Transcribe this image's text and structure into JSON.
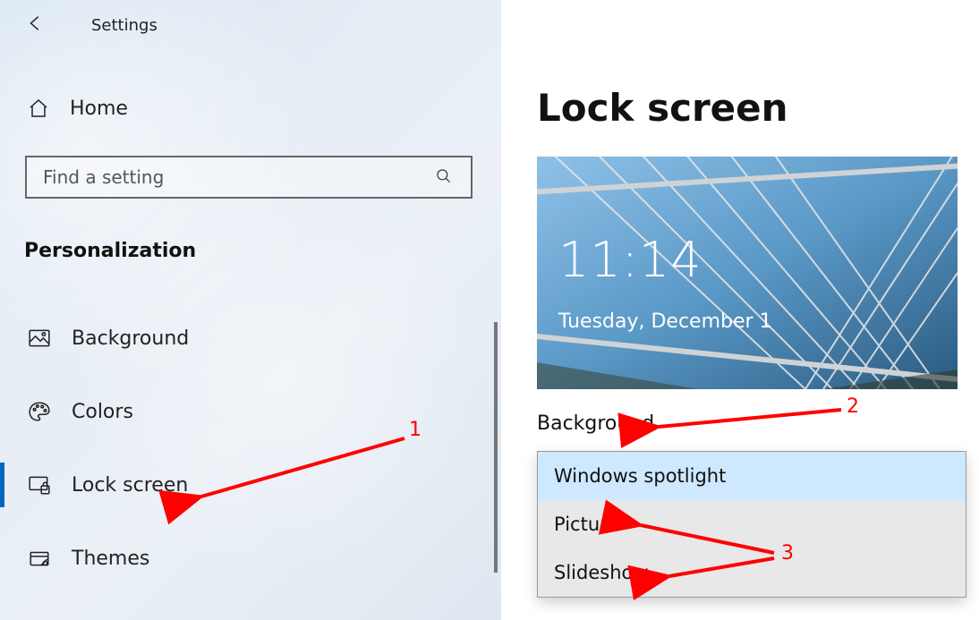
{
  "header": {
    "settings_title": "Settings"
  },
  "sidebar": {
    "home_label": "Home",
    "search_placeholder": "Find a setting",
    "category_title": "Personalization",
    "items": [
      {
        "label": "Background",
        "icon": "picture-icon",
        "active": false
      },
      {
        "label": "Colors",
        "icon": "palette-icon",
        "active": false
      },
      {
        "label": "Lock screen",
        "icon": "lockscreen-icon",
        "active": true
      },
      {
        "label": "Themes",
        "icon": "theme-icon",
        "active": false
      }
    ]
  },
  "main": {
    "page_title": "Lock screen",
    "preview": {
      "time": "11:14",
      "date": "Tuesday, December 1"
    },
    "background_label": "Background",
    "dropdown": {
      "selected_index": 0,
      "options": [
        "Windows spotlight",
        "Picture",
        "Slideshow"
      ]
    }
  },
  "annotations": {
    "n1": "1",
    "n2": "2",
    "n3": "3"
  },
  "colors": {
    "accent": "#0067c0",
    "annotation": "#ff0000",
    "dropdown_selected": "#cde8ff"
  }
}
